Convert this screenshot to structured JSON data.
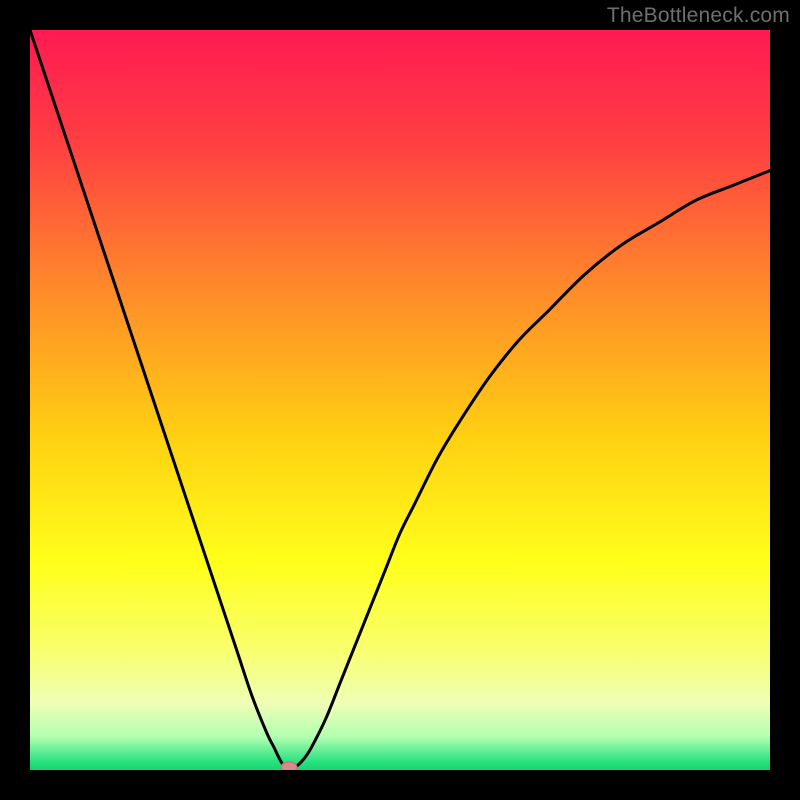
{
  "watermark": "TheBottleneck.com",
  "chart_data": {
    "type": "line",
    "title": "",
    "xlabel": "",
    "ylabel": "",
    "xlim": [
      0,
      100
    ],
    "ylim": [
      0,
      100
    ],
    "background_gradient": {
      "stops": [
        {
          "offset": 0.0,
          "color": "#ff1a52"
        },
        {
          "offset": 0.15,
          "color": "#ff3e42"
        },
        {
          "offset": 0.35,
          "color": "#ff8a2a"
        },
        {
          "offset": 0.55,
          "color": "#ffd012"
        },
        {
          "offset": 0.72,
          "color": "#ffff1a"
        },
        {
          "offset": 0.84,
          "color": "#f8ff70"
        },
        {
          "offset": 0.91,
          "color": "#efffb5"
        },
        {
          "offset": 0.955,
          "color": "#b2ffb2"
        },
        {
          "offset": 0.99,
          "color": "#25e07e"
        },
        {
          "offset": 1.0,
          "color": "#17d46a"
        }
      ]
    },
    "series": [
      {
        "name": "bottleneck-curve",
        "color": "#000000",
        "x": [
          0,
          2,
          4,
          6,
          8,
          10,
          12,
          14,
          16,
          18,
          20,
          22,
          24,
          26,
          28,
          30,
          32,
          33,
          34,
          35,
          36,
          37,
          38,
          40,
          42,
          44,
          46,
          48,
          50,
          52,
          55,
          58,
          62,
          66,
          70,
          75,
          80,
          85,
          90,
          95,
          100
        ],
        "values": [
          100,
          94,
          88,
          82,
          76,
          70,
          64,
          58,
          52,
          46,
          40,
          34,
          28,
          22,
          16,
          10,
          5,
          3,
          1,
          0,
          0.5,
          1.5,
          3,
          7,
          12,
          17,
          22,
          27,
          32,
          36,
          42,
          47,
          53,
          58,
          62,
          67,
          71,
          74,
          77,
          79,
          81
        ]
      }
    ],
    "marker": {
      "name": "optimum-marker",
      "x": 35,
      "y": 0,
      "fill": "#d98a8a",
      "stroke": "#c46f6f",
      "rx": 8,
      "ry": 5
    }
  }
}
